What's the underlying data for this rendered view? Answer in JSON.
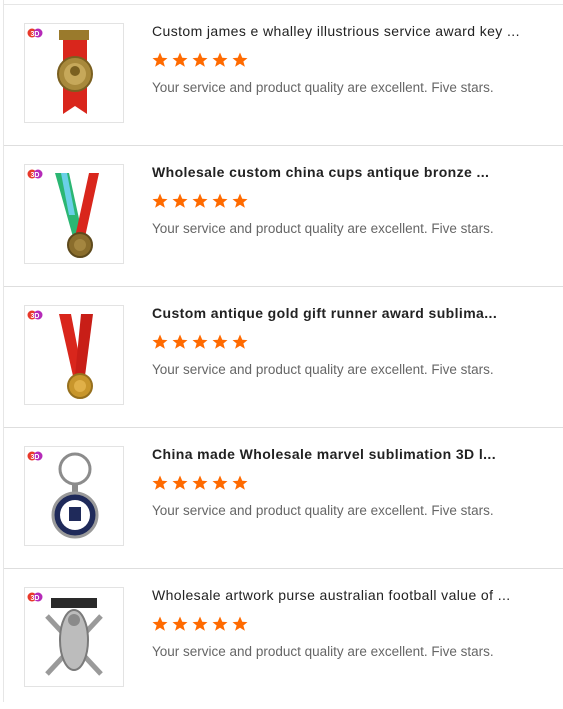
{
  "reviews": [
    {
      "title": "Custom james e whalley illustrious service award key ...",
      "rating": 5,
      "comment": "Your service and product quality are excellent. Five stars.",
      "image_icon": "award-key-medal-icon"
    },
    {
      "title": "Wholesale custom china cups antique bronze ...",
      "rating": 5,
      "comment": "Your service and product quality are excellent. Five stars.",
      "image_icon": "bronze-medal-icon"
    },
    {
      "title": "Custom antique gold gift runner award sublima...",
      "rating": 5,
      "comment": "Your service and product quality are excellent. Five stars.",
      "image_icon": "gold-runner-medal-icon"
    },
    {
      "title": "China made Wholesale marvel sublimation 3D l...",
      "rating": 5,
      "comment": "Your service and product quality are excellent. Five stars.",
      "image_icon": "keychain-icon"
    },
    {
      "title": "Wholesale artwork purse australian football value of ...",
      "rating": 5,
      "comment": "Your service and product quality are excellent. Five stars.",
      "image_icon": "football-badge-icon"
    }
  ],
  "colors": {
    "star": "#ff6a00",
    "title": "#222222",
    "comment": "#666666",
    "divider": "#dedede"
  }
}
